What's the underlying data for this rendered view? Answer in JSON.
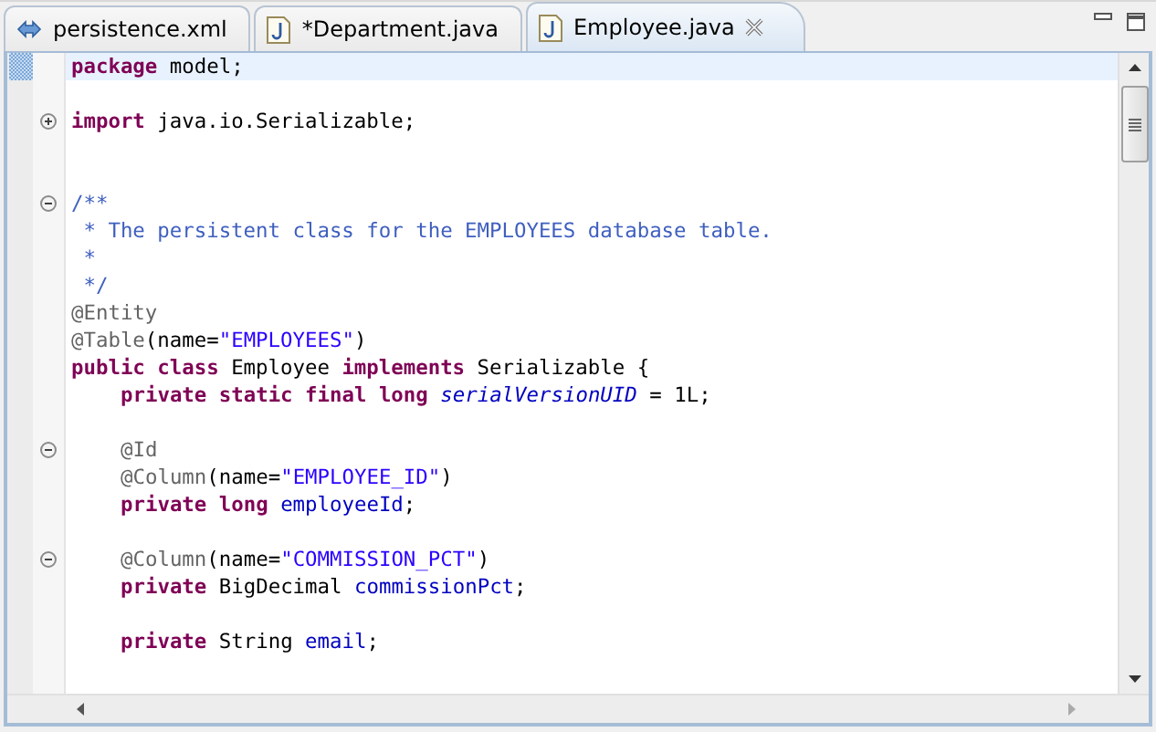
{
  "tabs": [
    {
      "label": "persistence.xml",
      "kind": "xml",
      "selected": false,
      "closable": false
    },
    {
      "label": "*Department.java",
      "kind": "java",
      "selected": false,
      "closable": false
    },
    {
      "label": "Employee.java",
      "kind": "java",
      "selected": true,
      "closable": true
    }
  ],
  "editor": {
    "lines": [
      {
        "kind": "code",
        "current": true,
        "tokens": [
          {
            "kind": "keyword",
            "text": "package"
          },
          {
            "kind": "plain",
            "text": " model;"
          }
        ]
      },
      {
        "kind": "blank"
      },
      {
        "kind": "code",
        "foldable": true,
        "expanded": false,
        "tokens": [
          {
            "kind": "keyword",
            "text": "import"
          },
          {
            "kind": "plain",
            "text": " java.io.Serializable;"
          }
        ]
      },
      {
        "kind": "blank"
      },
      {
        "kind": "blank"
      },
      {
        "kind": "code",
        "foldable": true,
        "expanded": true,
        "tokens": [
          {
            "kind": "comment",
            "text": "/**"
          }
        ]
      },
      {
        "kind": "code",
        "tokens": [
          {
            "kind": "comment",
            "text": " * The persistent class for the EMPLOYEES database table."
          }
        ]
      },
      {
        "kind": "code",
        "tokens": [
          {
            "kind": "comment",
            "text": " *"
          }
        ]
      },
      {
        "kind": "code",
        "tokens": [
          {
            "kind": "comment",
            "text": " */"
          }
        ]
      },
      {
        "kind": "code",
        "tokens": [
          {
            "kind": "annotation",
            "text": "@Entity"
          }
        ]
      },
      {
        "kind": "code",
        "tokens": [
          {
            "kind": "annotation",
            "text": "@Table"
          },
          {
            "kind": "plain",
            "text": "(name="
          },
          {
            "kind": "string",
            "text": "\"EMPLOYEES\""
          },
          {
            "kind": "plain",
            "text": ")"
          }
        ]
      },
      {
        "kind": "code",
        "tokens": [
          {
            "kind": "keyword",
            "text": "public class"
          },
          {
            "kind": "plain",
            "text": " Employee "
          },
          {
            "kind": "keyword",
            "text": "implements"
          },
          {
            "kind": "plain",
            "text": " Serializable {"
          }
        ]
      },
      {
        "kind": "code",
        "indented": true,
        "tokens": [
          {
            "kind": "keyword",
            "text": "private static final long"
          },
          {
            "kind": "static_field",
            "text": " serialVersionUID"
          },
          {
            "kind": "plain",
            "text": " = 1L;"
          }
        ]
      },
      {
        "kind": "blank"
      },
      {
        "kind": "code",
        "indented": true,
        "foldable": true,
        "expanded": true,
        "tokens": [
          {
            "kind": "annotation",
            "text": "@Id"
          }
        ]
      },
      {
        "kind": "code",
        "indented": true,
        "tokens": [
          {
            "kind": "annotation",
            "text": "@Column"
          },
          {
            "kind": "plain",
            "text": "(name="
          },
          {
            "kind": "string",
            "text": "\"EMPLOYEE_ID\""
          },
          {
            "kind": "plain",
            "text": ")"
          }
        ]
      },
      {
        "kind": "code",
        "indented": true,
        "tokens": [
          {
            "kind": "keyword",
            "text": "private long"
          },
          {
            "kind": "field",
            "text": " employeeId"
          },
          {
            "kind": "plain",
            "text": ";"
          }
        ]
      },
      {
        "kind": "blank"
      },
      {
        "kind": "code",
        "indented": true,
        "foldable": true,
        "expanded": true,
        "tokens": [
          {
            "kind": "annotation",
            "text": "@Column"
          },
          {
            "kind": "plain",
            "text": "(name="
          },
          {
            "kind": "string",
            "text": "\"COMMISSION_PCT\""
          },
          {
            "kind": "plain",
            "text": ")"
          }
        ]
      },
      {
        "kind": "code",
        "indented": true,
        "tokens": [
          {
            "kind": "keyword",
            "text": "private"
          },
          {
            "kind": "plain",
            "text": " BigDecimal "
          },
          {
            "kind": "field",
            "text": "commissionPct"
          },
          {
            "kind": "plain",
            "text": ";"
          }
        ]
      },
      {
        "kind": "blank"
      },
      {
        "kind": "code",
        "indented": true,
        "tokens": [
          {
            "kind": "keyword",
            "text": "private"
          },
          {
            "kind": "plain",
            "text": " String "
          },
          {
            "kind": "field",
            "text": "email"
          },
          {
            "kind": "plain",
            "text": ";"
          }
        ]
      },
      {
        "kind": "blank"
      }
    ]
  }
}
